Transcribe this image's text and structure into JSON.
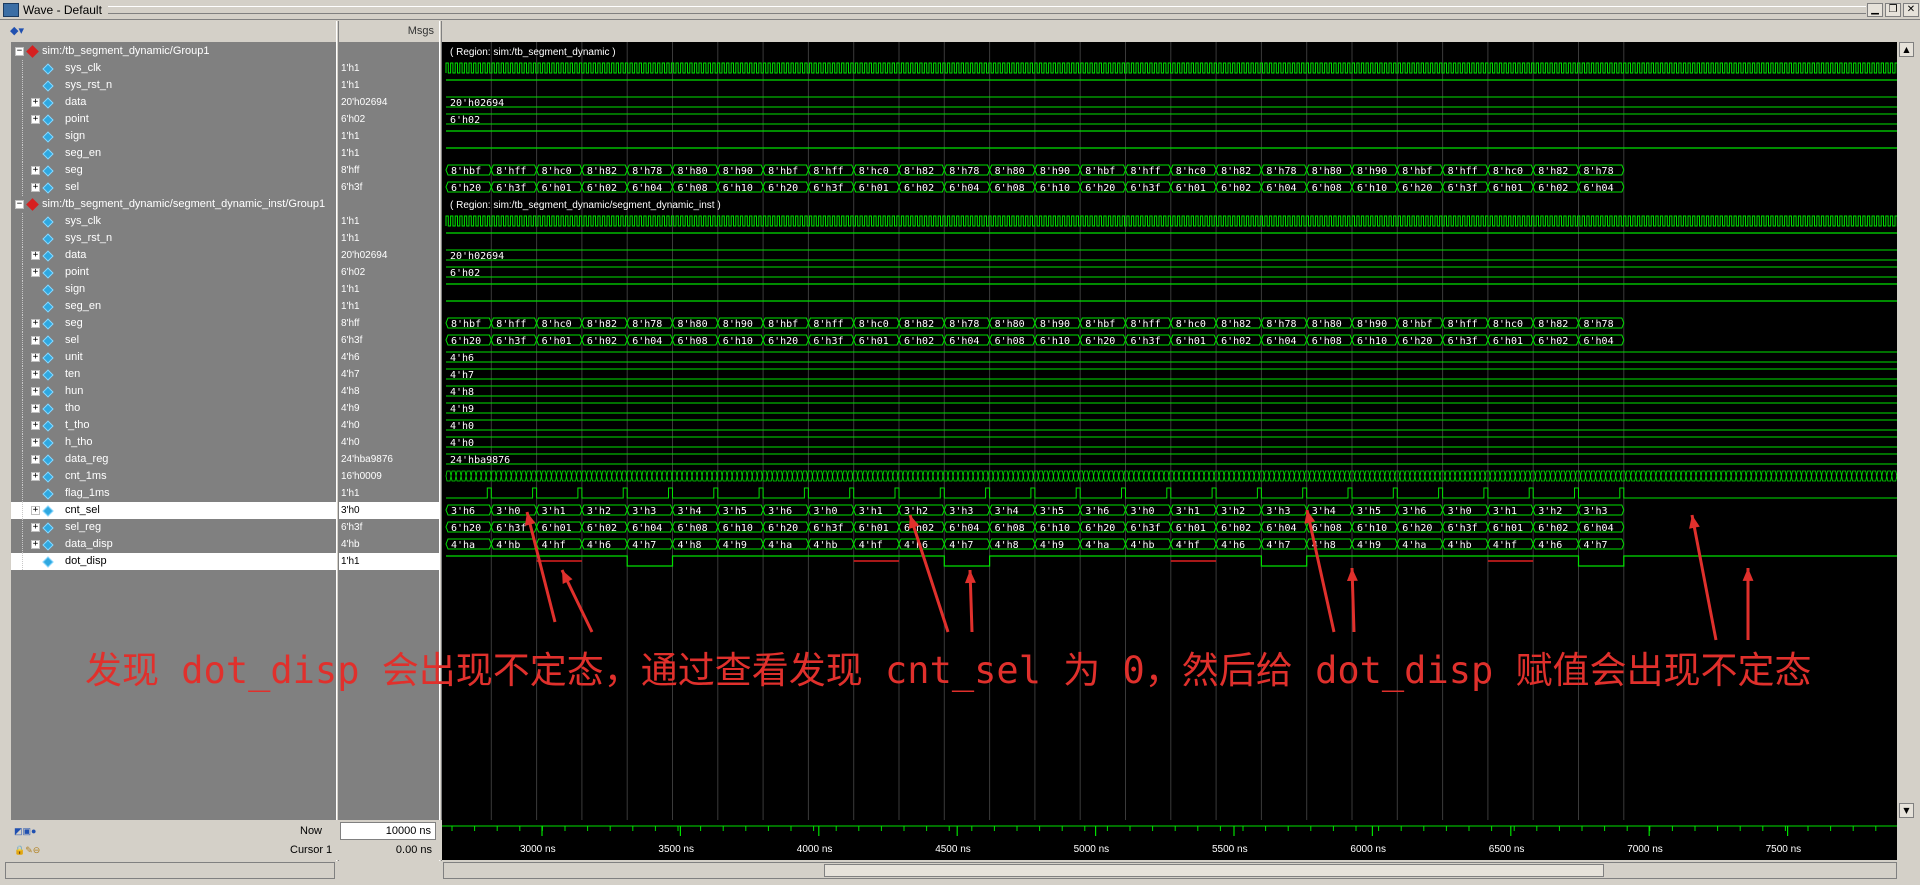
{
  "window": {
    "title": "Wave - Default"
  },
  "header": {
    "msgs_label": "Msgs"
  },
  "signals": [
    {
      "name": "sim:/tb_segment_dynamic/Group1",
      "value": "",
      "kind": "group",
      "indent": 0,
      "expandable": true
    },
    {
      "name": "sys_clk",
      "value": "1'h1",
      "kind": "bit",
      "indent": 1,
      "expandable": false
    },
    {
      "name": "sys_rst_n",
      "value": "1'h1",
      "kind": "bit",
      "indent": 1,
      "expandable": false
    },
    {
      "name": "data",
      "value": "20'h02694",
      "kind": "bus",
      "indent": 1,
      "expandable": true
    },
    {
      "name": "point",
      "value": "6'h02",
      "kind": "bus",
      "indent": 1,
      "expandable": true
    },
    {
      "name": "sign",
      "value": "1'h1",
      "kind": "bit",
      "indent": 1,
      "expandable": false
    },
    {
      "name": "seg_en",
      "value": "1'h1",
      "kind": "bit",
      "indent": 1,
      "expandable": false
    },
    {
      "name": "seg",
      "value": "8'hff",
      "kind": "bus",
      "indent": 1,
      "expandable": true
    },
    {
      "name": "sel",
      "value": "6'h3f",
      "kind": "bus",
      "indent": 1,
      "expandable": true
    },
    {
      "name": "sim:/tb_segment_dynamic/segment_dynamic_inst/Group1",
      "value": "",
      "kind": "group",
      "indent": 0,
      "expandable": true
    },
    {
      "name": "sys_clk",
      "value": "1'h1",
      "kind": "bit",
      "indent": 1,
      "expandable": false
    },
    {
      "name": "sys_rst_n",
      "value": "1'h1",
      "kind": "bit",
      "indent": 1,
      "expandable": false
    },
    {
      "name": "data",
      "value": "20'h02694",
      "kind": "bus",
      "indent": 1,
      "expandable": true
    },
    {
      "name": "point",
      "value": "6'h02",
      "kind": "bus",
      "indent": 1,
      "expandable": true
    },
    {
      "name": "sign",
      "value": "1'h1",
      "kind": "bit",
      "indent": 1,
      "expandable": false
    },
    {
      "name": "seg_en",
      "value": "1'h1",
      "kind": "bit",
      "indent": 1,
      "expandable": false
    },
    {
      "name": "seg",
      "value": "8'hff",
      "kind": "bus",
      "indent": 1,
      "expandable": true
    },
    {
      "name": "sel",
      "value": "6'h3f",
      "kind": "bus",
      "indent": 1,
      "expandable": true
    },
    {
      "name": "unit",
      "value": "4'h6",
      "kind": "bus",
      "indent": 1,
      "expandable": true
    },
    {
      "name": "ten",
      "value": "4'h7",
      "kind": "bus",
      "indent": 1,
      "expandable": true
    },
    {
      "name": "hun",
      "value": "4'h8",
      "kind": "bus",
      "indent": 1,
      "expandable": true
    },
    {
      "name": "tho",
      "value": "4'h9",
      "kind": "bus",
      "indent": 1,
      "expandable": true
    },
    {
      "name": "t_tho",
      "value": "4'h0",
      "kind": "bus",
      "indent": 1,
      "expandable": true
    },
    {
      "name": "h_tho",
      "value": "4'h0",
      "kind": "bus",
      "indent": 1,
      "expandable": true
    },
    {
      "name": "data_reg",
      "value": "24'hba9876",
      "kind": "bus",
      "indent": 1,
      "expandable": true
    },
    {
      "name": "cnt_1ms",
      "value": "16'h0009",
      "kind": "bus",
      "indent": 1,
      "expandable": true
    },
    {
      "name": "flag_1ms",
      "value": "1'h1",
      "kind": "bit",
      "indent": 1,
      "expandable": false
    },
    {
      "name": "cnt_sel",
      "value": "3'h0",
      "kind": "bus",
      "indent": 1,
      "expandable": true,
      "highlight": true
    },
    {
      "name": "sel_reg",
      "value": "6'h3f",
      "kind": "bus",
      "indent": 1,
      "expandable": true
    },
    {
      "name": "data_disp",
      "value": "4'hb",
      "kind": "bus",
      "indent": 1,
      "expandable": true
    },
    {
      "name": "dot_disp",
      "value": "1'h1",
      "kind": "bit",
      "indent": 1,
      "expandable": false,
      "highlight": true
    }
  ],
  "waves": {
    "region_labels": [
      "( Region: sim:/tb_segment_dynamic )",
      "( Region: sim:/tb_segment_dynamic/segment_dynamic_inst )"
    ],
    "data_value": "20'h02694",
    "point_value": "6'h02",
    "seg_seq": [
      "8'hbf",
      "8'hff",
      "8'hc0",
      "8'h82",
      "8'h78",
      "8'h80",
      "8'h90",
      "8'hbf",
      "8'hff",
      "8'hc0",
      "8'h82",
      "8'h78",
      "8'h80",
      "8'h90",
      "8'hbf",
      "8'hff",
      "8'hc0",
      "8'h82",
      "8'h78",
      "8'h80",
      "8'h90",
      "8'hbf",
      "8'hff",
      "8'hc0",
      "8'h82",
      "8'h78"
    ],
    "sel_seq": [
      "6'h20",
      "6'h3f",
      "6'h01",
      "6'h02",
      "6'h04",
      "6'h08",
      "6'h10",
      "6'h20",
      "6'h3f",
      "6'h01",
      "6'h02",
      "6'h04",
      "6'h08",
      "6'h10",
      "6'h20",
      "6'h3f",
      "6'h01",
      "6'h02",
      "6'h04",
      "6'h08",
      "6'h10",
      "6'h20",
      "6'h3f",
      "6'h01",
      "6'h02",
      "6'h04"
    ],
    "unit": "4'h6",
    "ten": "4'h7",
    "hun": "4'h8",
    "tho": "4'h9",
    "t_tho": "4'h0",
    "h_tho": "4'h0",
    "data_reg": "24'hba9876",
    "cnt_sel_seq": [
      "3'h6",
      "3'h0",
      "3'h1",
      "3'h2",
      "3'h3",
      "3'h4",
      "3'h5",
      "3'h6",
      "3'h0",
      "3'h1",
      "3'h2",
      "3'h3",
      "3'h4",
      "3'h5",
      "3'h6",
      "3'h0",
      "3'h1",
      "3'h2",
      "3'h3",
      "3'h4",
      "3'h5",
      "3'h6",
      "3'h0",
      "3'h1",
      "3'h2",
      "3'h3"
    ],
    "sel_reg_seq": [
      "6'h20",
      "6'h3f",
      "6'h01",
      "6'h02",
      "6'h04",
      "6'h08",
      "6'h10",
      "6'h20",
      "6'h3f",
      "6'h01",
      "6'h02",
      "6'h04",
      "6'h08",
      "6'h10",
      "6'h20",
      "6'h3f",
      "6'h01",
      "6'h02",
      "6'h04",
      "6'h08",
      "6'h10",
      "6'h20",
      "6'h3f",
      "6'h01",
      "6'h02",
      "6'h04"
    ],
    "data_disp_seq": [
      "4'ha",
      "4'hb",
      "4'hf",
      "4'h6",
      "4'h7",
      "4'h8",
      "4'h9",
      "4'ha",
      "4'hb",
      "4'hf",
      "4'h6",
      "4'h7",
      "4'h8",
      "4'h9",
      "4'ha",
      "4'hb",
      "4'hf",
      "4'h6",
      "4'h7",
      "4'h8",
      "4'h9",
      "4'ha",
      "4'hb",
      "4'hf",
      "4'h6",
      "4'h7"
    ]
  },
  "timeline": {
    "now_label": "Now",
    "now_value": "10000 ns",
    "cursor_label": "Cursor 1",
    "cursor_value": "0.00 ns",
    "ticks": [
      "3000 ns",
      "3500 ns",
      "4000 ns",
      "4500 ns",
      "5000 ns",
      "5500 ns",
      "6000 ns",
      "6500 ns",
      "7000 ns",
      "7500 ns"
    ]
  },
  "annotation": {
    "text": "发现 dot_disp 会出现不定态，通过查看发现 cnt_sel 为 0，然后给 dot_disp 赋值会出现不定态",
    "color": "#e0302c"
  },
  "colors": {
    "wave": "#00e000",
    "undefined": "#e02020",
    "grid": "#2a2a2a",
    "annotation": "#e0302c"
  }
}
